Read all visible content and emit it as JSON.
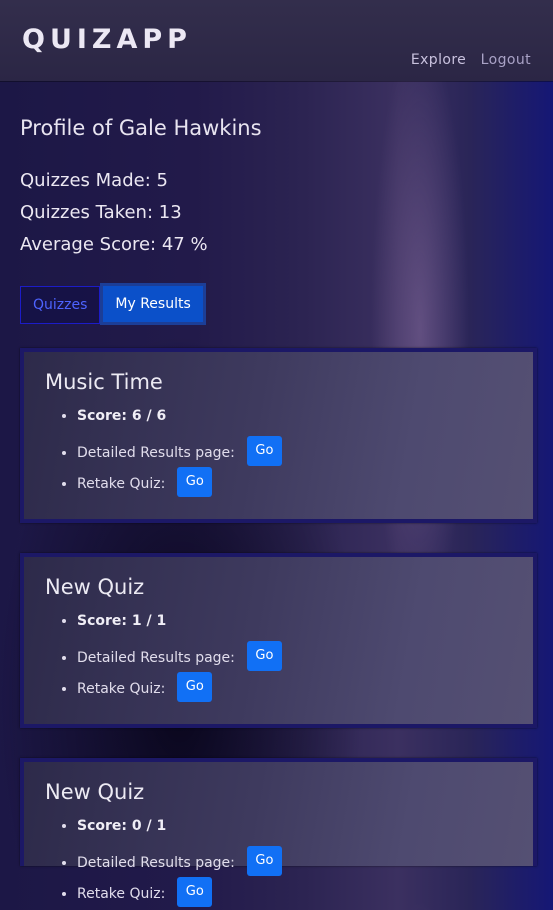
{
  "app": {
    "logo": "QUIZAPP"
  },
  "nav": {
    "explore": "Explore",
    "logout": "Logout"
  },
  "profile": {
    "title": "Profile of Gale Hawkins",
    "quizzes_made": "Quizzes Made: 5",
    "quizzes_taken": "Quizzes Taken: 13",
    "average_score": "Average Score: 47 %"
  },
  "tabs": [
    {
      "label": "Quizzes",
      "active": false
    },
    {
      "label": "My Results",
      "active": true
    }
  ],
  "results": [
    {
      "title": "Music Time",
      "score": "Score: 6 / 6",
      "detailed_label": "Detailed Results page:",
      "retake_label": "Retake Quiz:",
      "go": "Go"
    },
    {
      "title": "New Quiz",
      "score": "Score: 1 / 1",
      "detailed_label": "Detailed Results page:",
      "retake_label": "Retake Quiz:",
      "go": "Go"
    },
    {
      "title": "New Quiz",
      "score": "Score: 0 / 1",
      "detailed_label": "Detailed Results page:",
      "retake_label": "Retake Quiz:",
      "go": "Go"
    }
  ]
}
